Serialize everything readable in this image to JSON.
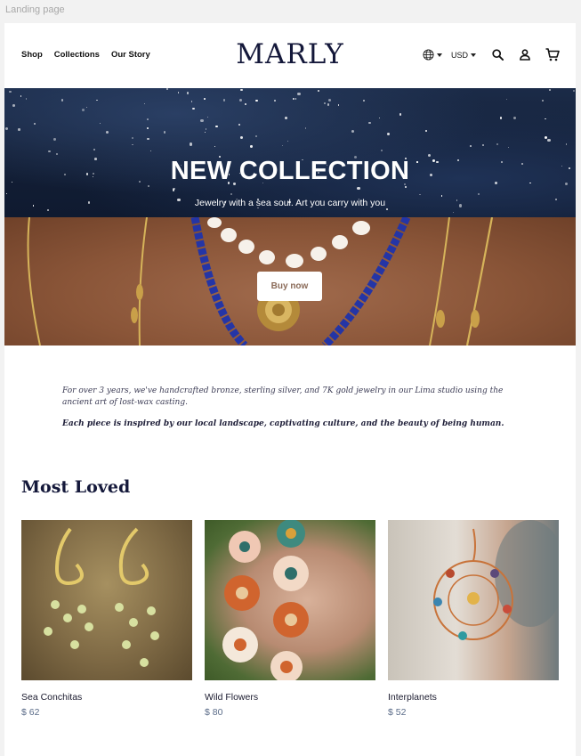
{
  "frame_label": "Landing page",
  "header": {
    "nav": [
      "Shop",
      "Collections",
      "Our Story"
    ],
    "logo": "MARLY",
    "currency": "USD"
  },
  "hero": {
    "title": "NEW COLLECTION",
    "subtitle": "Jewelry with a sea soul. Art you carry with you",
    "button": "Buy now"
  },
  "story": {
    "paragraph1": "For over 3 years, we've handcrafted bronze, sterling silver, and 7K gold jewelry in our Lima studio using the ancient art of lost-wax casting.",
    "paragraph2": "Each piece is inspired by our local landscape, captivating culture, and the beauty of being human."
  },
  "most_loved": {
    "title": "Most Loved",
    "products": [
      {
        "name": "Sea Conchitas",
        "price": "$ 62"
      },
      {
        "name": "Wild Flowers",
        "price": "$ 80"
      },
      {
        "name": "Interplanets",
        "price": "$ 52"
      }
    ]
  },
  "icons": [
    "globe-icon",
    "chevron-down-icon",
    "search-icon",
    "user-icon",
    "cart-icon"
  ],
  "colors": {
    "brand": "#14183a",
    "price": "#5a6b88",
    "button_text": "#8a6a58"
  }
}
